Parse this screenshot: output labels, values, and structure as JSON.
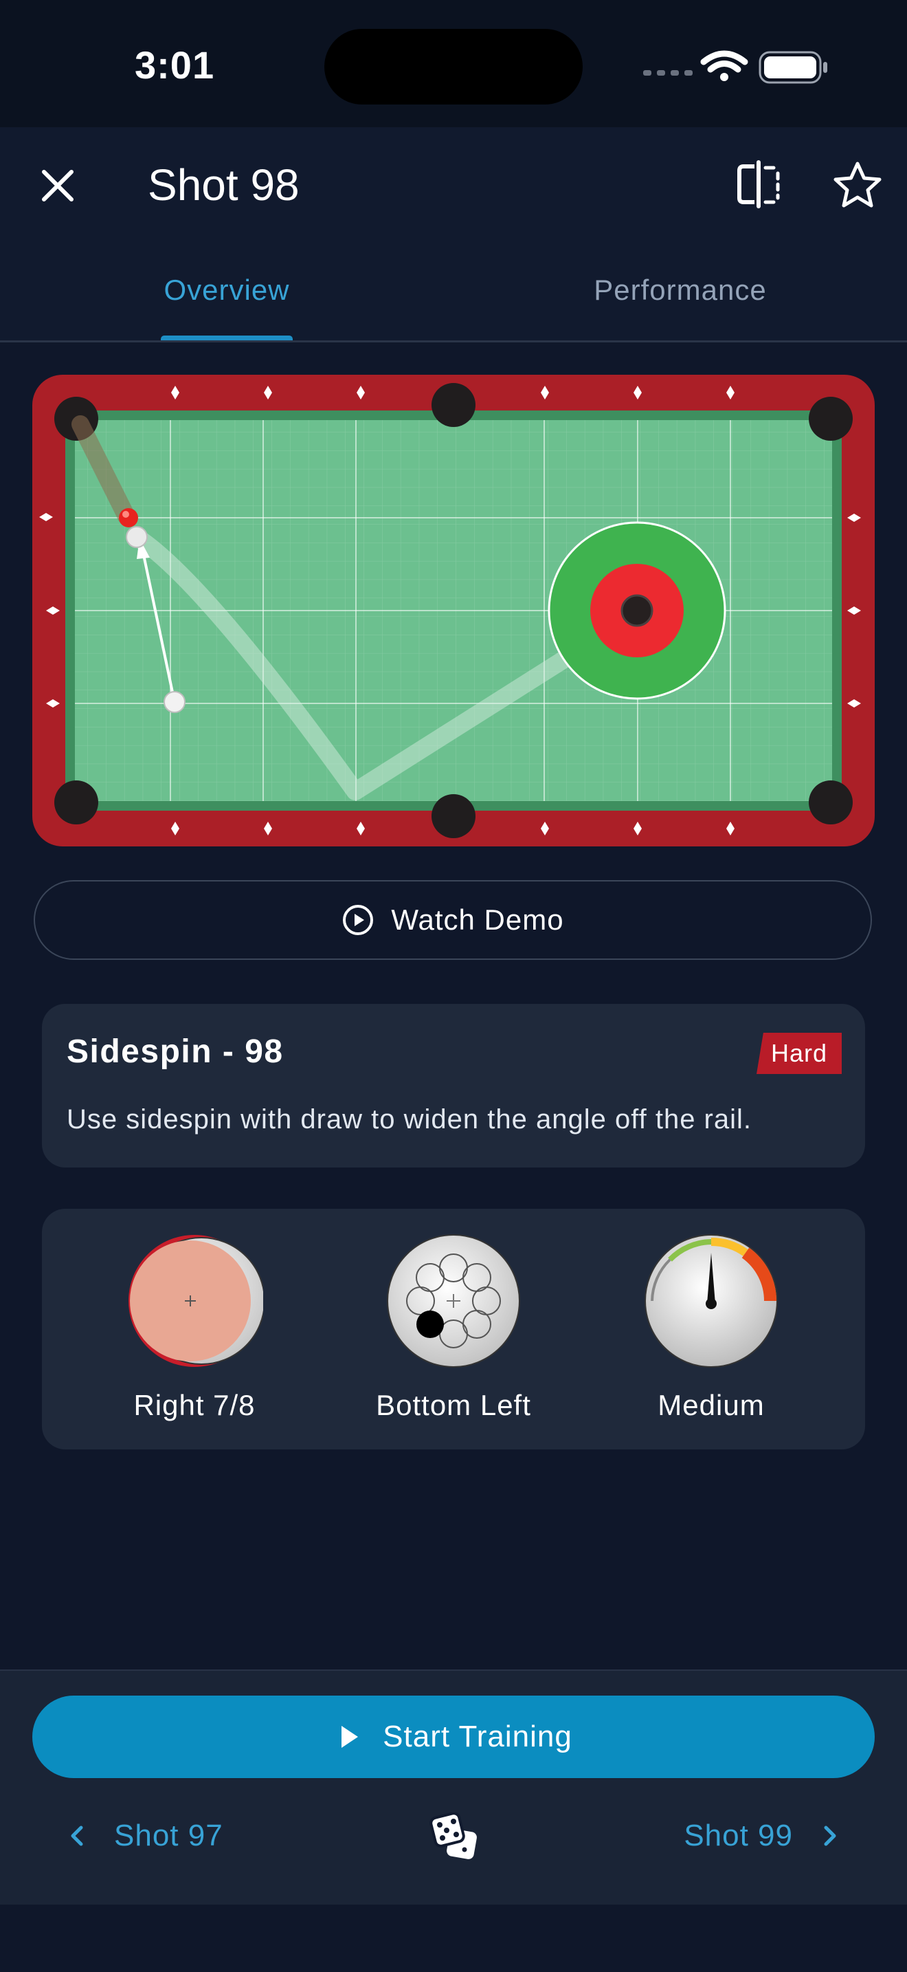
{
  "status_bar": {
    "time": "3:01"
  },
  "header": {
    "title": "Shot 98"
  },
  "tabs": [
    {
      "label": "Overview",
      "active": true
    },
    {
      "label": "Performance",
      "active": false
    }
  ],
  "colors": {
    "accent": "#38a3d6",
    "primary_button": "#0b8dc0",
    "felt": "#6cc08f",
    "rail": "#ab1f27",
    "badge": "#b91c28",
    "target_outer": "#3fb34f",
    "target_inner": "#ec2a30"
  },
  "table": {
    "balls": [
      "cue-ball",
      "object-ball-red"
    ],
    "target": "pocket-target"
  },
  "watch_demo": {
    "label": "Watch Demo"
  },
  "drill": {
    "title": "Sidespin - 98",
    "difficulty": "Hard",
    "description": "Use sidespin with draw to widen the angle off the rail."
  },
  "settings": [
    {
      "label": "Right 7/8",
      "icon": "cut-angle-icon"
    },
    {
      "label": "Bottom Left",
      "icon": "cue-tip-position-icon"
    },
    {
      "label": "Medium",
      "icon": "speed-gauge-icon"
    }
  ],
  "footer": {
    "start_label": "Start Training",
    "prev_label": "Shot 97",
    "next_label": "Shot 99"
  }
}
